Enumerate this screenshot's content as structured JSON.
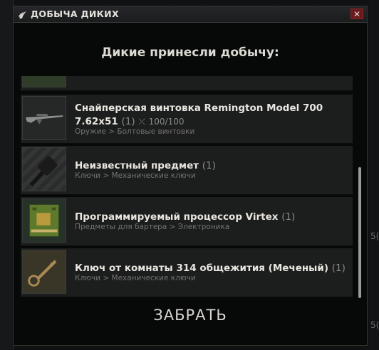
{
  "window": {
    "title": "ДОБЫЧА ДИКИХ",
    "close_label": "✕",
    "heading": "Дикие принесли добычу:",
    "take_button": "ЗАБРАТЬ"
  },
  "background": {
    "right_fragments": [
      "5(",
      "5("
    ]
  },
  "items": [
    {
      "name": "Снайперская винтовка Remington Model 700 7.62x51",
      "count": "(1)",
      "durability": "100/100",
      "category": "Оружие > Болтовые винтовки",
      "icon": "rifle-icon"
    },
    {
      "name": "Неизвестный предмет",
      "count": "(1)",
      "category": "Ключи > Механические ключи",
      "icon": "unknown-key-icon"
    },
    {
      "name": "Программируемый процессор Virtex",
      "count": "(1)",
      "category": "Предметы для бартера > Электроника",
      "icon": "processor-icon"
    },
    {
      "name": "Ключ от комнаты 314 общежития (Меченый)",
      "count": "(1)",
      "category": "Ключи > Механические ключи",
      "icon": "key-icon"
    }
  ],
  "colors": {
    "panel": "#1c1d1d",
    "window_bg": "#070808",
    "close_red": "#6a1a1a"
  }
}
